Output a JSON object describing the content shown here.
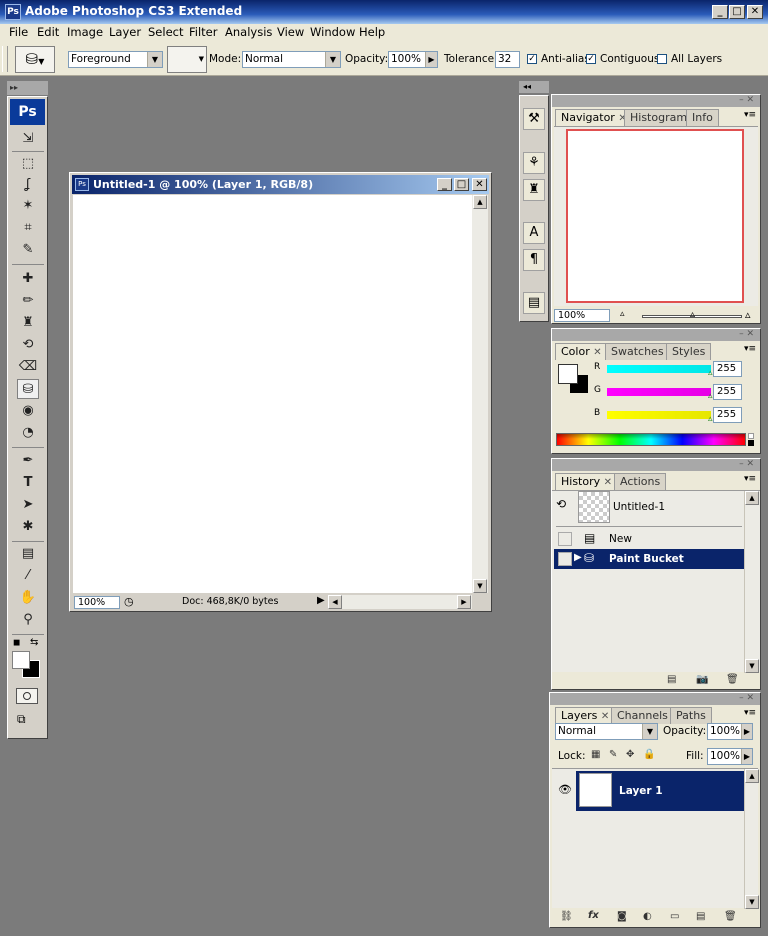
{
  "app": {
    "title": "Adobe Photoshop CS3 Extended",
    "logo": "Ps"
  },
  "menu": [
    "File",
    "Edit",
    "Image",
    "Layer",
    "Select",
    "Filter",
    "Analysis",
    "View",
    "Window",
    "Help"
  ],
  "options": {
    "fill_source": "Foreground",
    "mode_label": "Mode:",
    "mode_value": "Normal",
    "opacity_label": "Opacity:",
    "opacity_value": "100%",
    "tolerance_label": "Tolerance:",
    "tolerance_value": "32",
    "antialias_label": "Anti-alias",
    "contiguous_label": "Contiguous",
    "all_layers_label": "All Layers",
    "antialias_checked": true,
    "contiguous_checked": true,
    "all_layers_checked": false
  },
  "toolbox": {
    "logo": "Ps",
    "tools": [
      {
        "name": "move-tool",
        "glyph": "⇲"
      },
      {
        "name": "marquee-tool",
        "glyph": "⬚"
      },
      {
        "name": "lasso-tool",
        "glyph": "ʆ"
      },
      {
        "name": "magic-wand-tool",
        "glyph": "✨"
      },
      {
        "name": "crop-tool",
        "glyph": "⌗"
      },
      {
        "name": "slice-tool",
        "glyph": "✎"
      },
      {
        "name": "healing-brush-tool",
        "glyph": "✚"
      },
      {
        "name": "brush-tool",
        "glyph": "✏"
      },
      {
        "name": "clone-stamp-tool",
        "glyph": "♜"
      },
      {
        "name": "history-brush-tool",
        "glyph": "⟲"
      },
      {
        "name": "eraser-tool",
        "glyph": "⌫"
      },
      {
        "name": "paint-bucket-tool",
        "glyph": "⛁"
      },
      {
        "name": "blur-tool",
        "glyph": "💧"
      },
      {
        "name": "dodge-tool",
        "glyph": "◔"
      },
      {
        "name": "pen-tool",
        "glyph": "✒"
      },
      {
        "name": "type-tool",
        "glyph": "T"
      },
      {
        "name": "path-selection-tool",
        "glyph": "➤"
      },
      {
        "name": "custom-shape-tool",
        "glyph": "✱"
      },
      {
        "name": "notes-tool",
        "glyph": "▤"
      },
      {
        "name": "eyedropper-tool",
        "glyph": "⁄"
      },
      {
        "name": "hand-tool",
        "glyph": "✋"
      },
      {
        "name": "zoom-tool",
        "glyph": "🔍"
      }
    ]
  },
  "document": {
    "title": "Untitled-1 @ 100% (Layer 1, RGB/8)",
    "zoom": "100%",
    "doc_info": "Doc: 468,8K/0 bytes"
  },
  "navigator": {
    "tabs": [
      "Navigator",
      "Histogram",
      "Info"
    ],
    "zoom": "100%",
    "zoom_level": 0.5,
    "view_box_color": "#e05050"
  },
  "color": {
    "tabs": [
      "Color",
      "Swatches",
      "Styles"
    ],
    "channels": [
      {
        "label": "R",
        "value": "255",
        "level": 1.0,
        "gradient": "#00e6e6"
      },
      {
        "label": "G",
        "value": "255",
        "level": 1.0,
        "gradient": "#e600e6"
      },
      {
        "label": "B",
        "value": "255",
        "level": 1.0,
        "gradient": "#e6e600"
      }
    ]
  },
  "history": {
    "tabs": [
      "History",
      "Actions"
    ],
    "snapshot": "Untitled-1",
    "items": [
      {
        "label": "New",
        "selected": false
      },
      {
        "label": "Paint Bucket",
        "selected": true
      }
    ]
  },
  "layers": {
    "tabs": [
      "Layers",
      "Channels",
      "Paths"
    ],
    "blend_mode": "Normal",
    "opacity_label": "Opacity:",
    "opacity": "100%",
    "lock_label": "Lock:",
    "fill_label": "Fill:",
    "fill": "100%",
    "items": [
      {
        "name": "Layer 1",
        "visible": true,
        "selected": true
      }
    ]
  },
  "colors": {
    "title_gradient_start": "#0a246a",
    "selection": "#0a246a",
    "workspace": "#7b7b7b",
    "panel_bg": "#ece9d8"
  }
}
